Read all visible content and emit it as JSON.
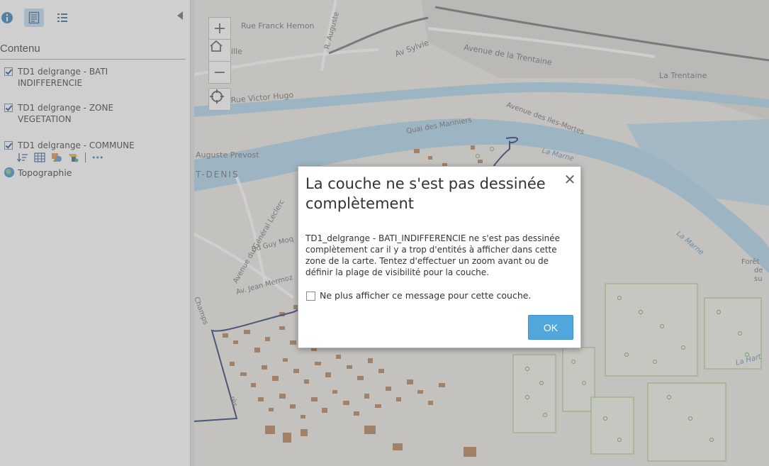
{
  "sidebar": {
    "tabs": [
      {
        "icon": "info-icon"
      },
      {
        "icon": "legend-icon"
      },
      {
        "icon": "list-icon"
      }
    ],
    "section_title": "Contenu",
    "layers": [
      {
        "label": "TD1 delgrange - BATI INDIFFERENCIE",
        "checked": true
      },
      {
        "label": "TD1 delgrange - ZONE VEGETATION",
        "checked": true
      },
      {
        "label": "TD1 delgrange - COMMUNE",
        "checked": true
      }
    ],
    "layer_tools": [
      "sort-icon",
      "table-icon",
      "symbol-icon",
      "analysis-icon",
      "more-icon"
    ],
    "more_label": "•••",
    "basemap": "Topographie"
  },
  "map": {
    "zoom_in": "+",
    "zoom_out": "−",
    "labels": {
      "rue_franck": "Rue Franck Hemon",
      "r_auguste": "R. Auguste",
      "av_sylvie": "Av Sylvie",
      "trentaine_av": "Avenue de la Trentaine",
      "la_trentaine": "La Trentaine",
      "ville": "ille",
      "victor_hugo": "Rue Victor Hugo",
      "quai": "Quai des Mariniers",
      "iles_mortes": "Avenue des Iles-Mortes",
      "la_marne_1": "La Marne",
      "la_marne_2": "La Marne",
      "auguste_prevost": "Auguste Prevost",
      "st_denis": "T-DENIS",
      "leclerc": "Avenue du Général Leclerc",
      "guy_moq": "Bd Guy Moq",
      "jean_mermoz": "Av. Jean Mermoz",
      "champs": "Champs",
      "foret": "Forêt",
      "de": "de",
      "su": "su",
      "la_hart": "La Hart",
      "pres": "rès"
    }
  },
  "dialog": {
    "title": "La couche ne s'est pas dessinée complètement",
    "message": "TD1_delgrange - BATI_INDIFFERENCIE ne s'est pas dessinée complètement car il y a trop d'entités à afficher dans cette zone de la carte. Tentez d'effectuer un zoom avant ou de définir la plage de visibilité pour la couche.",
    "checkbox_label": "Ne plus afficher ce message pour cette couche.",
    "ok_label": "OK",
    "close_glyph": "✕"
  },
  "colors": {
    "accent": "#51a7dc",
    "river": "#a9d3e9",
    "building": "#b07a4e",
    "vegetation": "#6aa84f",
    "commune_boundary": "#1f2e6e"
  }
}
